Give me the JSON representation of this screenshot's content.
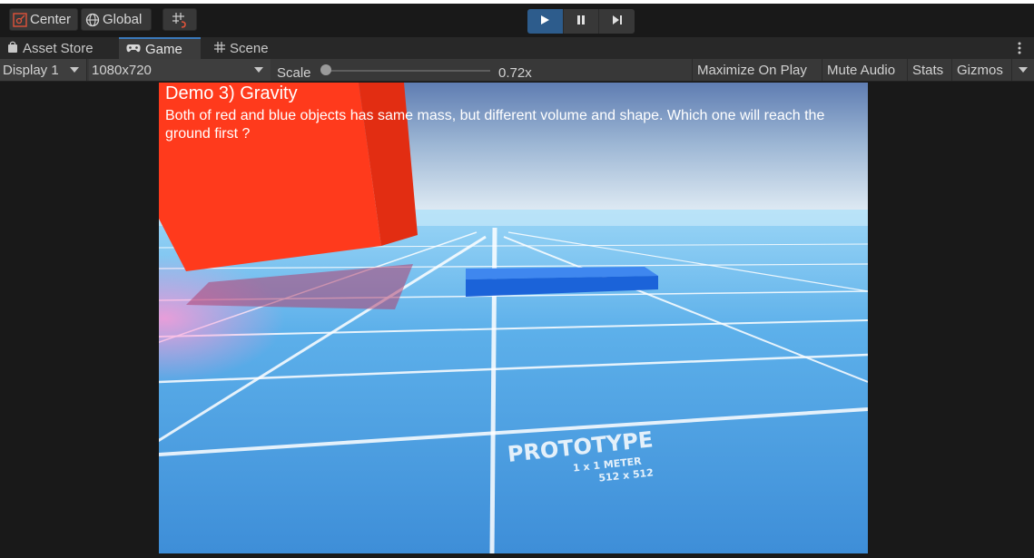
{
  "toolbar": {
    "pivot_label": "Center",
    "space_label": "Global"
  },
  "tabs": [
    {
      "label": "Asset Store",
      "icon": "bag-icon"
    },
    {
      "label": "Game",
      "icon": "gamepad-icon",
      "active": true
    },
    {
      "label": "Scene",
      "icon": "grid-icon"
    }
  ],
  "game_toolbar": {
    "display": "Display 1",
    "resolution": "1080x720",
    "scale_label": "Scale",
    "scale_value": "0.72x",
    "scale_fraction": 0.0,
    "maximize_on_play": "Maximize On Play",
    "mute_audio": "Mute Audio",
    "stats": "Stats",
    "gizmos": "Gizmos"
  },
  "game_view": {
    "title": "Demo 3) Gravity",
    "description": "Both of red and blue objects has same mass, but different volume and shape. Which one will reach the ground first ?",
    "prototype_text": "PROTOTYPE",
    "prototype_sub1": "1 x 1 METER",
    "prototype_sub2": "512 x 512"
  },
  "colors": {
    "accent": "#3a79bb",
    "play_active": "#2d5c8c",
    "red_cube": "#ff3a1c",
    "blue_slab": "#1f6fe0",
    "floor": "#4aa3e6"
  }
}
